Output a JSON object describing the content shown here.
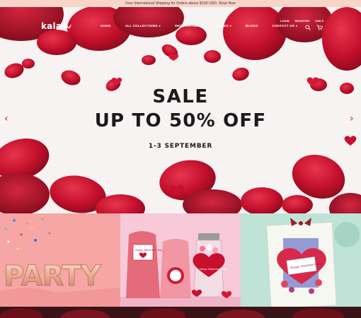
{
  "announcement": "Free International Shipping for Orders above $100 USD. Shop Now",
  "brand": {
    "logo_text": "kala"
  },
  "nav": {
    "items": [
      {
        "label": "HOME",
        "has_dropdown": false,
        "active": true
      },
      {
        "label": "ALL COLLECTIONS",
        "has_dropdown": true,
        "active": false
      },
      {
        "label": "SHOP LAYOUT",
        "has_dropdown": true,
        "active": false
      },
      {
        "label": "PAGES",
        "has_dropdown": true,
        "active": false
      },
      {
        "label": "BLOGS",
        "has_dropdown": false,
        "active": false
      },
      {
        "label": "CONTACT US",
        "has_dropdown": true,
        "active": false
      }
    ],
    "account": {
      "login": "LOGIN",
      "register": "REGISTER",
      "currency": "USD $"
    },
    "icons": [
      "search-icon",
      "cart-icon"
    ]
  },
  "hero": {
    "line1": "SALE",
    "line2": "UP TO 50% OFF",
    "line3": "1-3 SEPTEMBER",
    "prev_arrow": "‹",
    "next_arrow": "›",
    "slides_total": 3,
    "slide_active": 1
  },
  "banners": [
    {
      "name": "party-balloons",
      "balloon_text": "PARTY"
    },
    {
      "name": "valentine-favor-jars",
      "tag_1": "Happy Valentine's Day",
      "tag_2": "Happy Valentine's Day"
    },
    {
      "name": "valentine-card",
      "card_text": "Happy Valentine's Day"
    }
  ],
  "colors": {
    "accent": "#c2185b",
    "announcement_bg": "#f7d5c8",
    "rose": "#c8102e",
    "banner1_bg": "#f6a6a5",
    "banner2_bg": "#f7c9d9",
    "banner3_bg": "#bfe3d6"
  }
}
